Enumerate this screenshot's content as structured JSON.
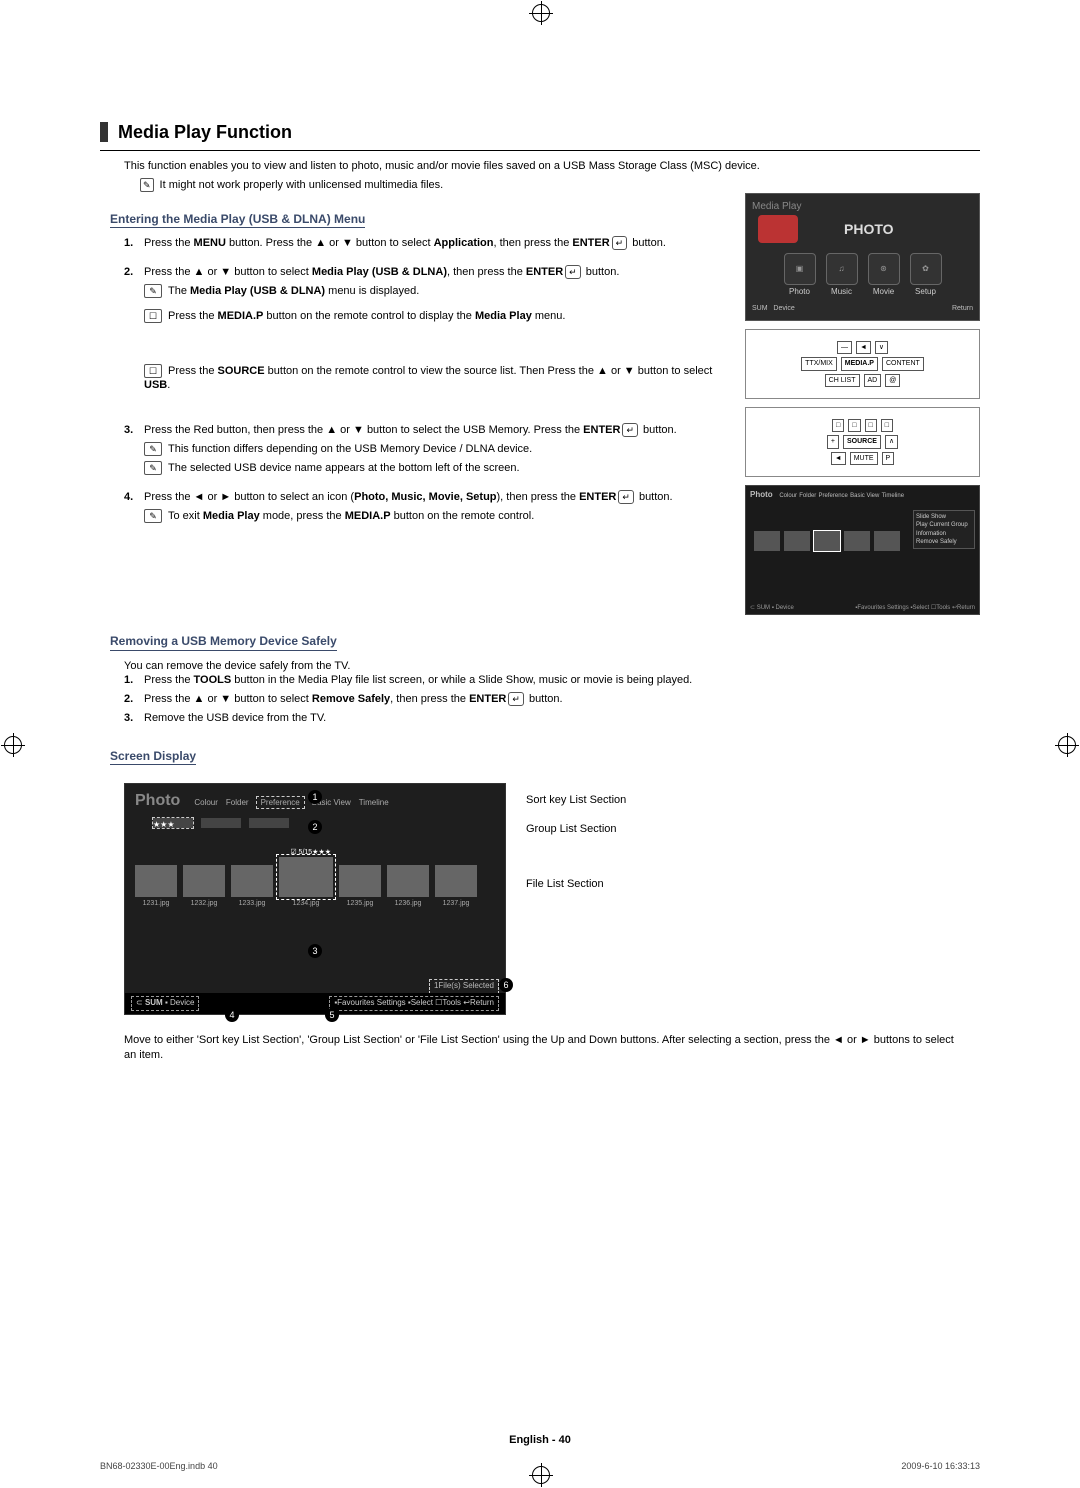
{
  "heading": "Media Play Function",
  "intro": "This function enables you to view and listen to photo, music and/or movie files saved on a USB Mass Storage Class (MSC) device.",
  "intro_note": "It might not work properly with unlicensed multimedia files.",
  "sub1": "Entering the Media Play (USB & DLNA) Menu",
  "steps1": {
    "s1a": "Press the ",
    "s1b": "MENU",
    "s1c": " button. Press the ▲ or ▼ button to select ",
    "s1d": "Application",
    "s1e": ", then press the ",
    "s1f": "ENTER",
    "s1g": " button.",
    "s2a": "Press the ▲ or ▼ button to select ",
    "s2b": "Media Play (USB & DLNA)",
    "s2c": ", then press the ",
    "s2d": "ENTER",
    "s2e": " button.",
    "s2n1a": "The ",
    "s2n1b": "Media Play (USB & DLNA)",
    "s2n1c": " menu is displayed.",
    "s2n2a": "Press the ",
    "s2n2b": "MEDIA.P",
    "s2n2c": " button on the remote control to display the ",
    "s2n2d": "Media Play",
    "s2n2e": " menu.",
    "s2n3a": "Press the ",
    "s2n3b": "SOURCE",
    "s2n3c": " button on the remote control to view the source list. Then Press the ▲ or ▼ button to select ",
    "s2n3d": "USB",
    "s2n3e": ".",
    "s3a": "Press the Red button, then press the ▲ or ▼ button to select the USB Memory. Press the ",
    "s3b": "ENTER",
    "s3c": " button.",
    "s3n1": "This function differs depending on the USB Memory Device / DLNA device.",
    "s3n2": "The selected USB device name appears at the bottom left of the screen.",
    "s4a": "Press the ◄ or ► button to select an icon (",
    "s4b": "Photo, Music, Movie, Setup",
    "s4c": "), then press the ",
    "s4d": "ENTER",
    "s4e": " button.",
    "s4n1a": "To exit ",
    "s4n1b": "Media Play",
    "s4n1c": " mode, press the ",
    "s4n1d": "MEDIA.P",
    "s4n1e": " button on the remote control."
  },
  "sub2": "Removing a USB Memory Device Safely",
  "remove_intro": "You can remove the device safely from the TV.",
  "r1a": "Press the ",
  "r1b": "TOOLS",
  "r1c": " button in the Media Play file list screen, or while a Slide Show, music or movie is being played.",
  "r2a": "Press the ▲ or ▼ button to select ",
  "r2b": "Remove Safely",
  "r2c": ", then press the ",
  "r2d": "ENTER",
  "r2e": " button.",
  "r3": "Remove the USB device from the TV.",
  "sub3": "Screen Display",
  "callout1": "Sort key List Section",
  "callout2": "Group List Section",
  "callout3": "File List Section",
  "final_para": "Move to either 'Sort key List Section', 'Group List Section' or 'File List Section' using the Up and Down buttons. After selecting a section, press the ◄ or ► buttons to select an item.",
  "footer": "English - 40",
  "bottom_left": "BN68-02330E-00Eng.indb   40",
  "bottom_right": "2009-6-10   16:33:13",
  "enter_glyph": "↵",
  "media": {
    "title": "Media Play",
    "photo": "PHOTO",
    "tiles": [
      "Photo",
      "Music",
      "Movie",
      "Setup"
    ],
    "sum": "SUM",
    "device": "Device",
    "return": "Return"
  },
  "remote": {
    "row1": [
      "—",
      "◄",
      "∨"
    ],
    "row2": [
      "TTX/MIX",
      "MEDIA.P",
      "CONTENT"
    ],
    "row3": [
      "CH LIST",
      "AD",
      "@"
    ],
    "row4": [
      "□",
      "□",
      "□",
      "□"
    ],
    "row5": [
      "+",
      "SOURCE",
      "∧"
    ],
    "row6": [
      "◄",
      "MUTE",
      "P"
    ]
  },
  "sd": {
    "ph": "Photo",
    "tabs": [
      "Colour",
      "Folder",
      "Preference",
      "Basic View",
      "Timeline"
    ],
    "counter": "5/15",
    "stars": "★★★",
    "files": [
      "1231.jpg",
      "1232.jpg",
      "1233.jpg",
      "1234.jpg",
      "1235.jpg",
      "1236.jpg",
      "1237.jpg"
    ],
    "selected": "1File(s) Selected",
    "sum": "SUM",
    "device": "Device",
    "bottom": [
      "Favourites Settings",
      "Select",
      "Tools",
      "Return"
    ]
  }
}
